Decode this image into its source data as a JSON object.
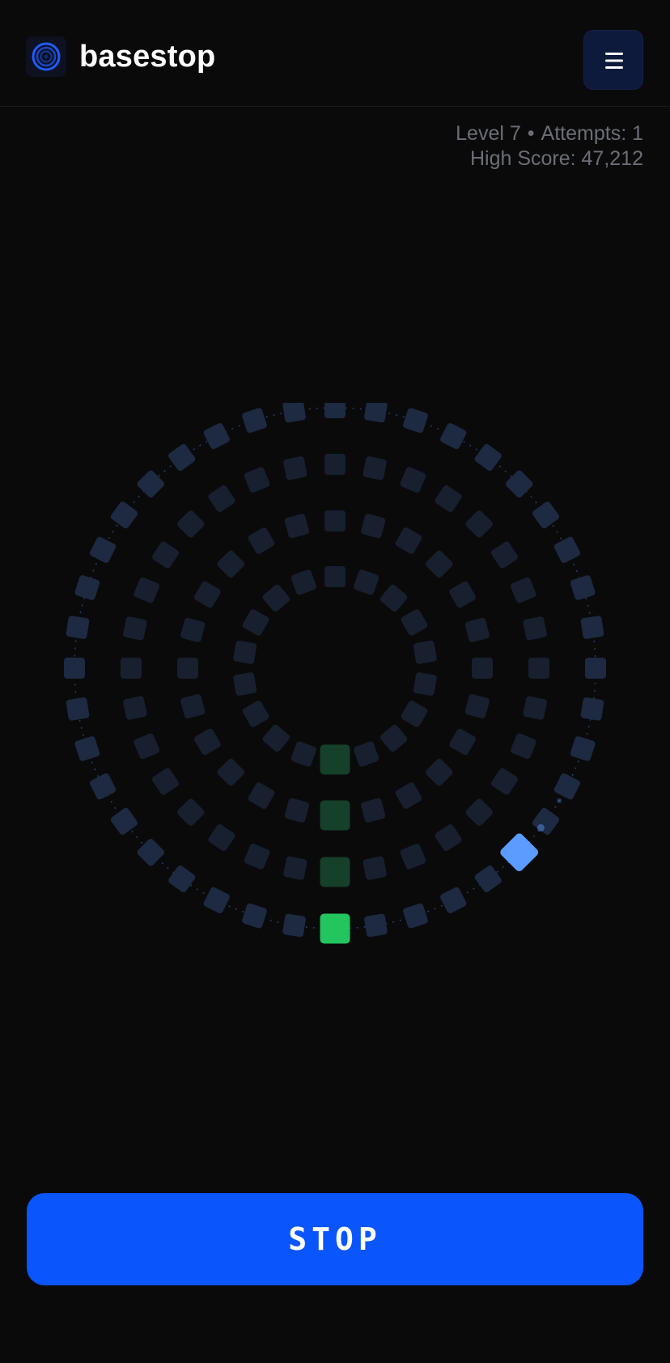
{
  "app": {
    "brand": "basestop"
  },
  "header": {
    "menu_icon": "hamburger-menu-icon",
    "logo_icon": "concentric-rings-icon"
  },
  "stats": {
    "level_text": "Level 7",
    "separator": "•",
    "attempts_text": "Attempts: 1",
    "high_score_text": "High Score: 47,212"
  },
  "game": {
    "rings": [
      {
        "tile_count": 40,
        "target_tile_index": 0
      },
      {
        "tile_count": 32,
        "target_tile_index": 0
      },
      {
        "tile_count": 24,
        "target_tile_index": 0
      },
      {
        "tile_count": 18,
        "target_tile_index": 0
      }
    ],
    "active_ring_index": 0,
    "cursor_position_fraction": 0.875,
    "colors": {
      "tile": "#1b2436",
      "tile_outer": "#1d2a42",
      "target_active": "#22c55e",
      "target_inactive": "#15402a",
      "cursor": "#5a9cff",
      "track": "#23406a",
      "background": "#0a0a0b"
    }
  },
  "controls": {
    "stop_label": "STOP",
    "stop_color": "#0a55fc"
  }
}
